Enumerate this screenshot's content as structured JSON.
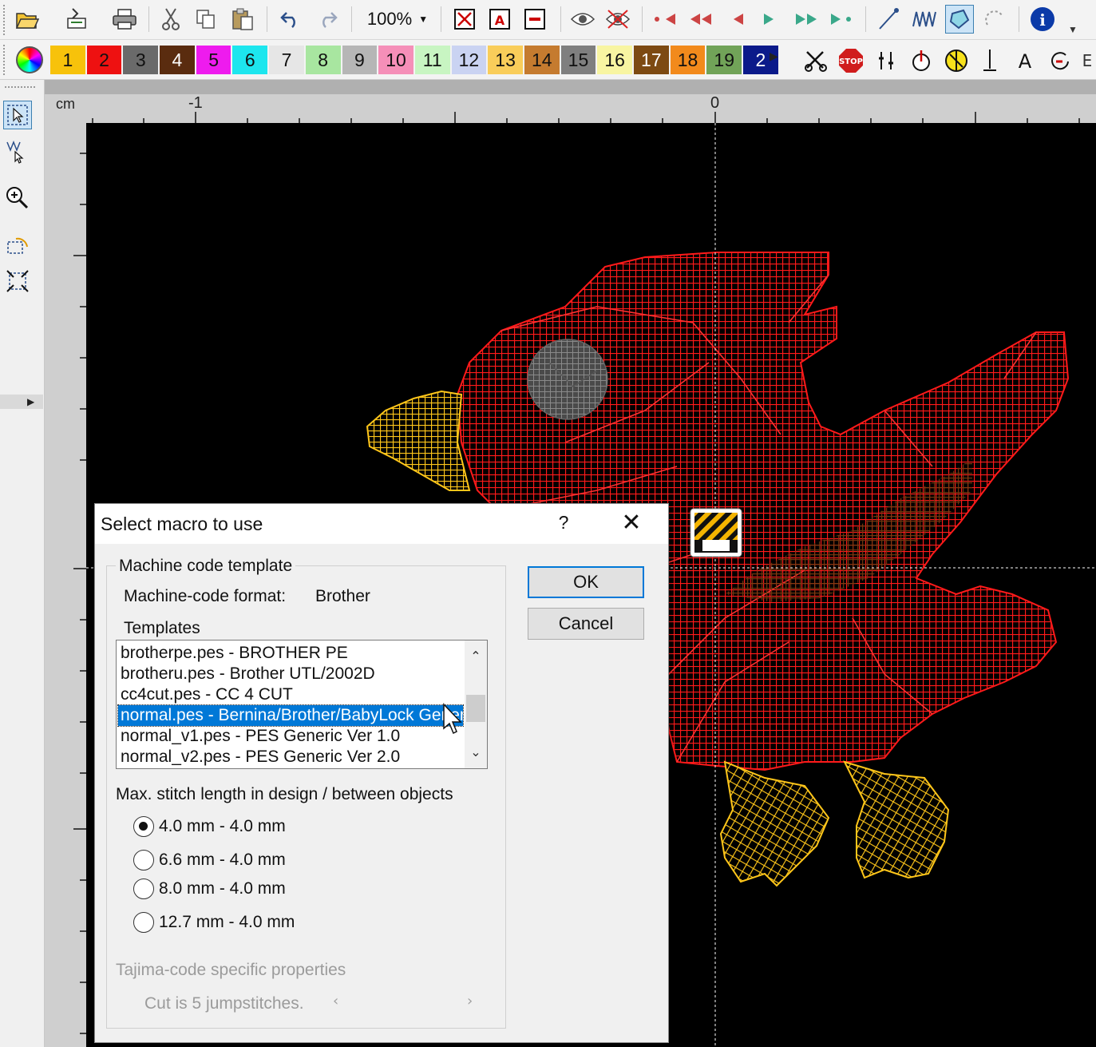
{
  "toolbar": {
    "zoom": "100%",
    "icons": [
      "open-icon",
      "import-icon",
      "print-icon",
      "cut-icon",
      "copy-icon",
      "paste-icon",
      "undo-icon",
      "redo-icon",
      "zoom-dropdown",
      "select-object-icon",
      "select-text-icon",
      "select-line-icon",
      "preview-icon",
      "hide-preview-icon",
      "first-stitch-icon",
      "previous-color-icon",
      "previous-stitch-icon",
      "next-stitch-icon",
      "next-color-icon",
      "last-stitch-icon",
      "line-tool-icon",
      "column-tool-icon",
      "fill-tool-icon",
      "running-stitch-icon",
      "info-icon"
    ]
  },
  "palette": {
    "swatches": [
      {
        "label": "1",
        "color": "#f7c20b"
      },
      {
        "label": "2",
        "color": "#ee1111"
      },
      {
        "label": "3",
        "color": "#6a6a6a"
      },
      {
        "label": "4",
        "color": "#5a2c0f"
      },
      {
        "label": "5",
        "color": "#ee1bee"
      },
      {
        "label": "6",
        "color": "#1de6ee"
      },
      {
        "label": "7",
        "color": "#e6e6e6"
      },
      {
        "label": "8",
        "color": "#a8e6a0"
      },
      {
        "label": "9",
        "color": "#b6b6b6"
      },
      {
        "label": "10",
        "color": "#f58fb8"
      },
      {
        "label": "11",
        "color": "#c8f5c2"
      },
      {
        "label": "12",
        "color": "#cad3f2"
      },
      {
        "label": "13",
        "color": "#f9cd5a"
      },
      {
        "label": "14",
        "color": "#c57b2f"
      },
      {
        "label": "15",
        "color": "#7f7f7f"
      },
      {
        "label": "16",
        "color": "#f8f5a2"
      },
      {
        "label": "17",
        "color": "#7d4a12"
      },
      {
        "label": "18",
        "color": "#f28a1c"
      },
      {
        "label": "19",
        "color": "#71a358"
      },
      {
        "label": "2",
        "color": "#0b1a8a"
      }
    ],
    "tools_right": [
      "scissors-icon",
      "stop-icon",
      "trim-icon",
      "needle-stop-icon",
      "color-change-icon",
      "needle-icon",
      "text-icon",
      "reset-icon"
    ],
    "cut_letter": "E"
  },
  "left_tools": [
    "select-pointer-icon",
    "node-edit-icon",
    "zoom-icon",
    "rotate-icon",
    "resize-icon"
  ],
  "ruler": {
    "unit": "cm",
    "labels": [
      "-1",
      "0"
    ]
  },
  "dialog": {
    "title": "Select macro to use",
    "help": "?",
    "close": "✕",
    "group_title": "Machine code template",
    "format_label": "Machine-code format:",
    "format_value": "Brother",
    "templates_label": "Templates",
    "templates": [
      "brotherpe.pes - BROTHER PE",
      "brotheru.pes - Brother UTL/2002D",
      "cc4cut.pes - CC 4 CUT",
      "normal.pes - Bernina/Brother/BabyLock Generic",
      "normal_v1.pes - PES Generic Ver 1.0",
      "normal_v2.pes - PES Generic Ver 2.0"
    ],
    "selected_index": 3,
    "stitch_label": "Max. stitch length in design / between objects",
    "stitch_options": [
      "4.0 mm  -  4.0 mm",
      "6.6 mm  -  4.0 mm",
      "8.0 mm  -  4.0 mm",
      "12.7 mm  -  4.0 mm"
    ],
    "stitch_selected": 0,
    "tajima_label": "Tajima-code specific properties",
    "cut_label": "Cut is 5 jumpstitches.",
    "ok": "OK",
    "cancel": "Cancel"
  }
}
